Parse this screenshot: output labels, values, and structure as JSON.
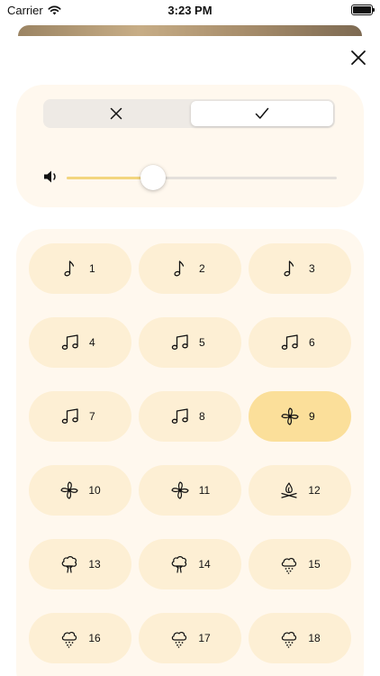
{
  "status_bar": {
    "carrier": "Carrier",
    "time": "3:23 PM"
  },
  "colors": {
    "card_bg": "#fff8ee",
    "sound_button": "#fdefd4",
    "sound_button_selected": "#fbdf9a",
    "volume_fill": "#f3d67e"
  },
  "segmented_control": {
    "options": [
      {
        "icon": "xmark-icon",
        "selected": false
      },
      {
        "icon": "checkmark-icon",
        "selected": true
      }
    ]
  },
  "volume": {
    "icon": "speaker-icon",
    "level": 0.32
  },
  "sounds": [
    {
      "label": "1",
      "icon": "music-note-icon",
      "selected": false
    },
    {
      "label": "2",
      "icon": "music-note-icon",
      "selected": false
    },
    {
      "label": "3",
      "icon": "music-note-icon",
      "selected": false
    },
    {
      "label": "4",
      "icon": "music-notes-icon",
      "selected": false
    },
    {
      "label": "5",
      "icon": "music-notes-icon",
      "selected": false
    },
    {
      "label": "6",
      "icon": "music-notes-icon",
      "selected": false
    },
    {
      "label": "7",
      "icon": "music-notes-icon",
      "selected": false
    },
    {
      "label": "8",
      "icon": "music-notes-icon",
      "selected": false
    },
    {
      "label": "9",
      "icon": "fan-icon",
      "selected": true
    },
    {
      "label": "10",
      "icon": "fan-icon",
      "selected": false
    },
    {
      "label": "11",
      "icon": "fan-icon",
      "selected": false
    },
    {
      "label": "12",
      "icon": "campfire-icon",
      "selected": false
    },
    {
      "label": "13",
      "icon": "tree-icon",
      "selected": false
    },
    {
      "label": "14",
      "icon": "tree-icon",
      "selected": false
    },
    {
      "label": "15",
      "icon": "rain-cloud-icon",
      "selected": false
    },
    {
      "label": "16",
      "icon": "rain-cloud-icon",
      "selected": false
    },
    {
      "label": "17",
      "icon": "rain-cloud-icon",
      "selected": false
    },
    {
      "label": "18",
      "icon": "rain-cloud-icon",
      "selected": false
    }
  ]
}
